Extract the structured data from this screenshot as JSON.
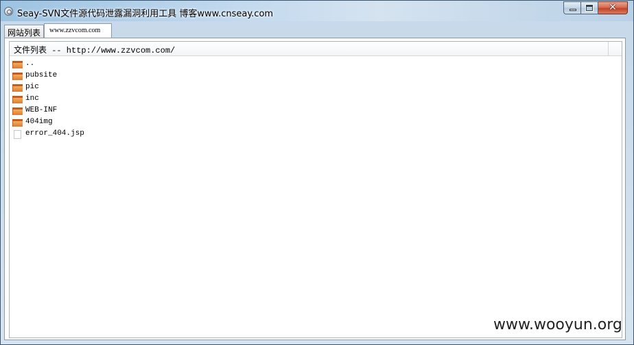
{
  "window": {
    "title": "Seay-SVN文件源代码泄露漏洞利用工具  博客www.cnseay.com",
    "buttons": {
      "minimize": "minimize-icon",
      "maximize": "maximize-icon",
      "close": "close-icon"
    }
  },
  "tabs": [
    {
      "label": "网站列表"
    },
    {
      "label": "www.zzvcom.com",
      "active": true
    }
  ],
  "file_list": {
    "header": "文件列表 -- http://www.zzvcom.com/",
    "items": [
      {
        "name": "..",
        "icon": "folder-icon"
      },
      {
        "name": "pubsite",
        "icon": "folder-icon"
      },
      {
        "name": "pic",
        "icon": "folder-icon"
      },
      {
        "name": "inc",
        "icon": "folder-icon"
      },
      {
        "name": "WEB-INF",
        "icon": "folder-icon"
      },
      {
        "name": "404img",
        "icon": "folder-icon"
      },
      {
        "name": "error_404.jsp",
        "icon": "file-icon"
      }
    ]
  },
  "watermark": "www.wooyun.org",
  "colors": {
    "folder": "#e07830",
    "title_close": "#c2432a"
  }
}
